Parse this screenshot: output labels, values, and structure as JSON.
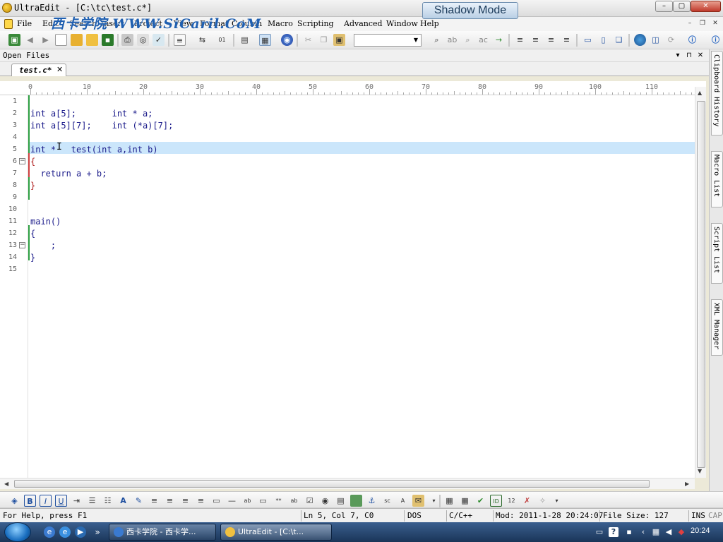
{
  "window": {
    "title": "UltraEdit - [C:\\tc\\test.c*]",
    "watermark": "西卡学院 WWW.SiCaril.CoM",
    "shadow_mode": "Shadow Mode",
    "minimize": "–",
    "maximize": "▢",
    "close": "✕"
  },
  "menu": {
    "items": [
      "File",
      "Edit",
      "Search",
      "Insert",
      "Project",
      "View",
      "Format",
      "Column",
      "Macro",
      "Scripting",
      "Advanced",
      "Window",
      "Help"
    ],
    "mdi_min": "–",
    "mdi_restore": "❐",
    "mdi_close": "✕"
  },
  "toolbar_top": {
    "icons": [
      "save-all-icon",
      "back-icon",
      "forward-icon",
      "new-file-icon",
      "open-folder-icon",
      "open-icon",
      "save-icon",
      "print-icon",
      "print-preview-icon",
      "spellcheck-icon",
      "page-icon",
      "wordwrap-icon",
      "hex-icon",
      "column-mode-icon",
      "ruler-icon",
      "globe-icon",
      "cut-icon",
      "copy-icon",
      "paste-icon",
      "find-icon",
      "replace-icon",
      "find-in-files-icon",
      "replace-in-files-icon",
      "goto-icon",
      "align-left-icon",
      "align-center-icon",
      "align-right-icon",
      "justify-icon",
      "split-horizontal-icon",
      "split-vertical-icon",
      "window-icon",
      "browser-icon",
      "preview-icon",
      "refresh-icon",
      "info-icon"
    ],
    "search_value": ""
  },
  "open_files": {
    "label": "Open Files",
    "pin": "▾",
    "float": "⊓",
    "close": "✕"
  },
  "tabs": [
    {
      "label": "test.c*",
      "close": "✕"
    }
  ],
  "ruler": {
    "labels": [
      "0",
      "10",
      "20",
      "30",
      "40",
      "50",
      "60",
      "70",
      "80",
      "90",
      "100",
      "110"
    ]
  },
  "editor": {
    "line_numbers": [
      "1",
      "2",
      "3",
      "4",
      "5",
      "6",
      "7",
      "8",
      "9",
      "10",
      "11",
      "12",
      "13",
      "14",
      "15"
    ],
    "lines": [
      "",
      "int a[5];       int * a;",
      "int a[5][7];    int (*a)[7];",
      "",
      "int *   test(int a,int b)",
      "{",
      "  return a + b;",
      "}",
      "",
      "",
      "main()",
      "{",
      "    ;",
      "}",
      ""
    ],
    "cursor_glyph": "I",
    "current_line": 5
  },
  "side_panels": [
    "Clipboard History",
    "Macro List",
    "Script List",
    "XML Manager"
  ],
  "toolbar_bottom": {
    "icons": [
      "html-icon",
      "bold-icon",
      "italic-icon",
      "underline-icon",
      "indent-icon",
      "bullets-icon",
      "numbered-list-icon",
      "font-icon",
      "edit-icon",
      "align-left-icon",
      "align-center-icon",
      "align-right-icon",
      "table-icon",
      "hr-icon",
      "textbox-icon",
      "input-icon",
      "password-icon",
      "textarea-icon",
      "checkbox-icon",
      "radio-icon",
      "select-icon",
      "image-icon",
      "anchor-icon",
      "script-icon",
      "style-icon",
      "mail-icon",
      "grid-icon",
      "table-insert-icon",
      "validate-icon",
      "id-icon",
      "number-icon",
      "tools-icon",
      "options-icon"
    ]
  },
  "status": {
    "help": "For Help, press F1",
    "position": "Ln 5, Col 7, C0",
    "line_ending": "DOS",
    "language": "C/C++",
    "modified": "Mod: 2011-1-28 20:24:07",
    "file_size": "File Size: 127",
    "insert_mode": "INS",
    "caps": "CAP"
  },
  "taskbar": {
    "tasks": [
      {
        "label": "西卡学院 - 西卡学..."
      },
      {
        "label": "UltraEdit - [C:\\t..."
      }
    ],
    "overflow": "»",
    "clock": "20:24"
  }
}
